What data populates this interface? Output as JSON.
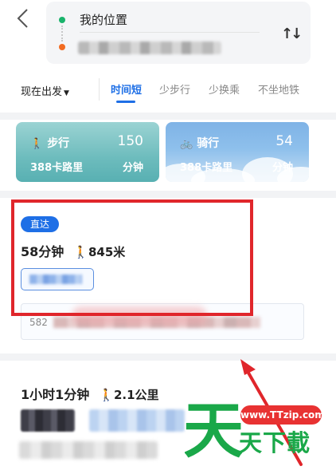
{
  "header": {
    "origin_label": "我的位置",
    "swap_icon": "swap-vertical-icon"
  },
  "filters": {
    "depart_label": "现在出发",
    "tabs": [
      {
        "label": "时间短",
        "active": true
      },
      {
        "label": "少步行",
        "active": false
      },
      {
        "label": "少换乘",
        "active": false
      },
      {
        "label": "不坐地铁",
        "active": false
      }
    ]
  },
  "mode_cards": {
    "walk": {
      "icon": "walking-person-icon",
      "title": "步行",
      "value": "150",
      "calories": "388卡路里",
      "unit": "分钟"
    },
    "bike": {
      "icon": "bicycle-icon",
      "title": "骑行",
      "value": "54",
      "calories": "388卡路里",
      "unit": "分钟"
    }
  },
  "routes": [
    {
      "badge": "直达",
      "duration": "58分钟",
      "walk_icon": "walking-person-icon",
      "walk_distance": "845米",
      "detail_prefix": "582"
    },
    {
      "duration": "1小时1分钟",
      "walk_icon": "walking-person-icon",
      "walk_distance": "2.1公里"
    }
  ],
  "watermark": {
    "url": "www.TTzip.com",
    "text": "天下載",
    "logo_char": "天"
  },
  "colors": {
    "accent_blue": "#1e6fe6",
    "highlight_red": "#e0262b",
    "watermark_green": "#1aa849"
  }
}
